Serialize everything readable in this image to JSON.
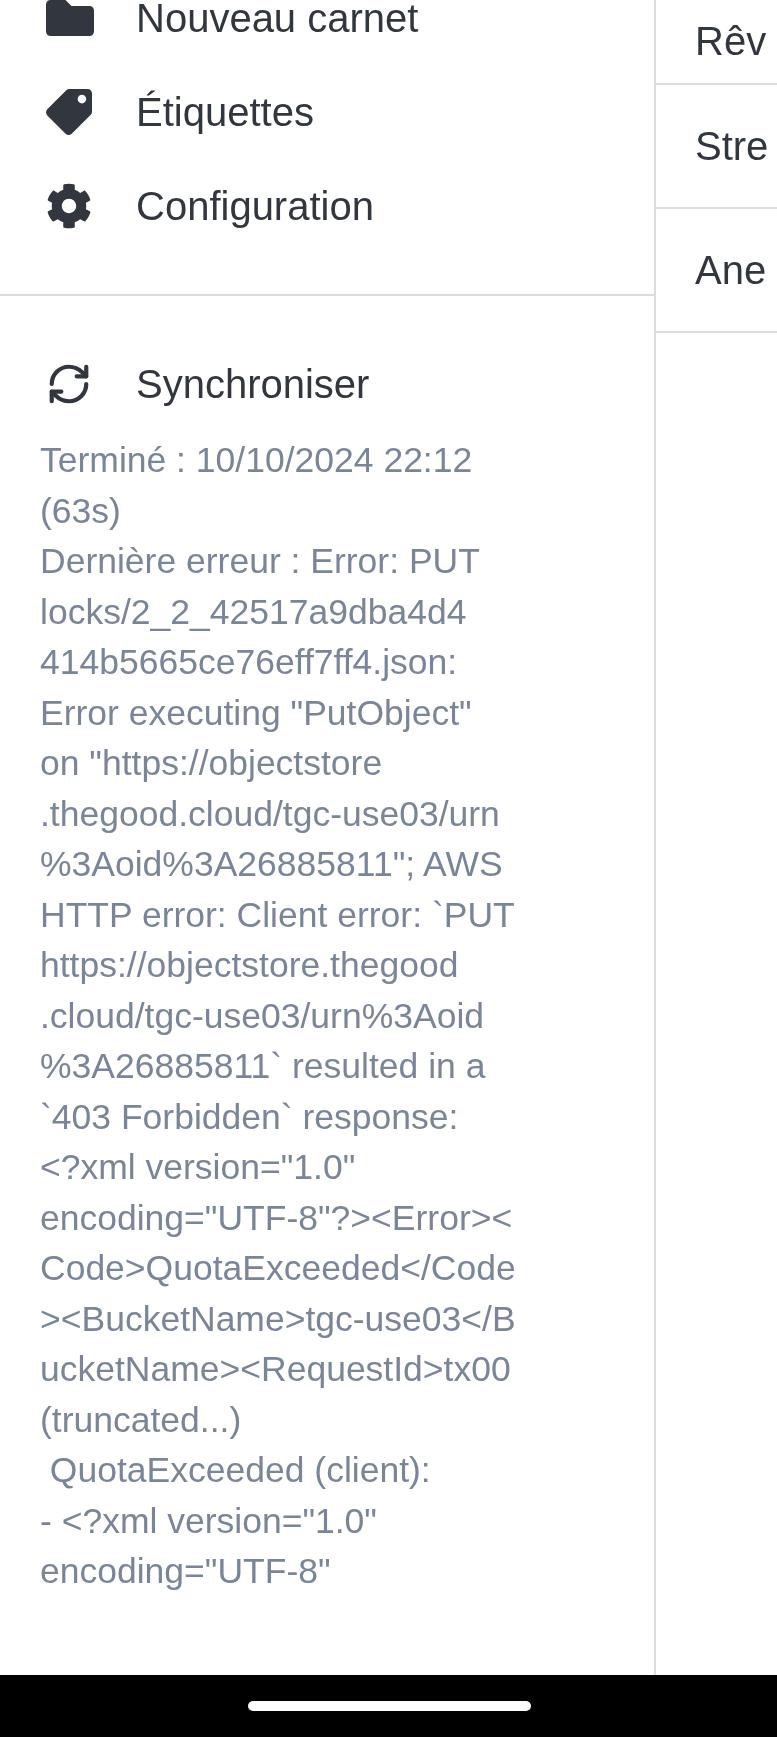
{
  "sidebar": {
    "items": [
      {
        "kind": "folder",
        "label": "Nouveau carnet"
      },
      {
        "kind": "tag",
        "label": "Étiquettes"
      },
      {
        "kind": "settings",
        "label": "Configuration"
      }
    ],
    "sync": {
      "label": "Synchroniser",
      "status": "Terminé : 10/10/2024 22:12\n(63s)\nDernière erreur : Error: PUT\nlocks/2_2_42517a9dba4d4\n414b5665ce76eff7ff4.json:\nError executing \"PutObject\"\non \"https://objectstore\n.thegood.cloud/tgc-use03/urn\n%3Aoid%3A26885811\"; AWS\nHTTP error: Client error: `PUT\nhttps://objectstore.thegood\n.cloud/tgc-use03/urn%3Aoid\n%3A26885811` resulted in a\n`403 Forbidden` response:\n<?xml version=\"1.0\"\nencoding=\"UTF-8\"?><Error><\nCode>QuotaExceeded</Code\n><BucketName>tgc-use03</B\nucketName><RequestId>tx00\n(truncated...)\n QuotaExceeded (client):\n- <?xml version=\"1.0\"\nencoding=\"UTF-8\""
    }
  },
  "note_list": {
    "items": [
      {
        "title": "Rêv"
      },
      {
        "title": "Stre"
      },
      {
        "title": "Ane"
      }
    ]
  }
}
